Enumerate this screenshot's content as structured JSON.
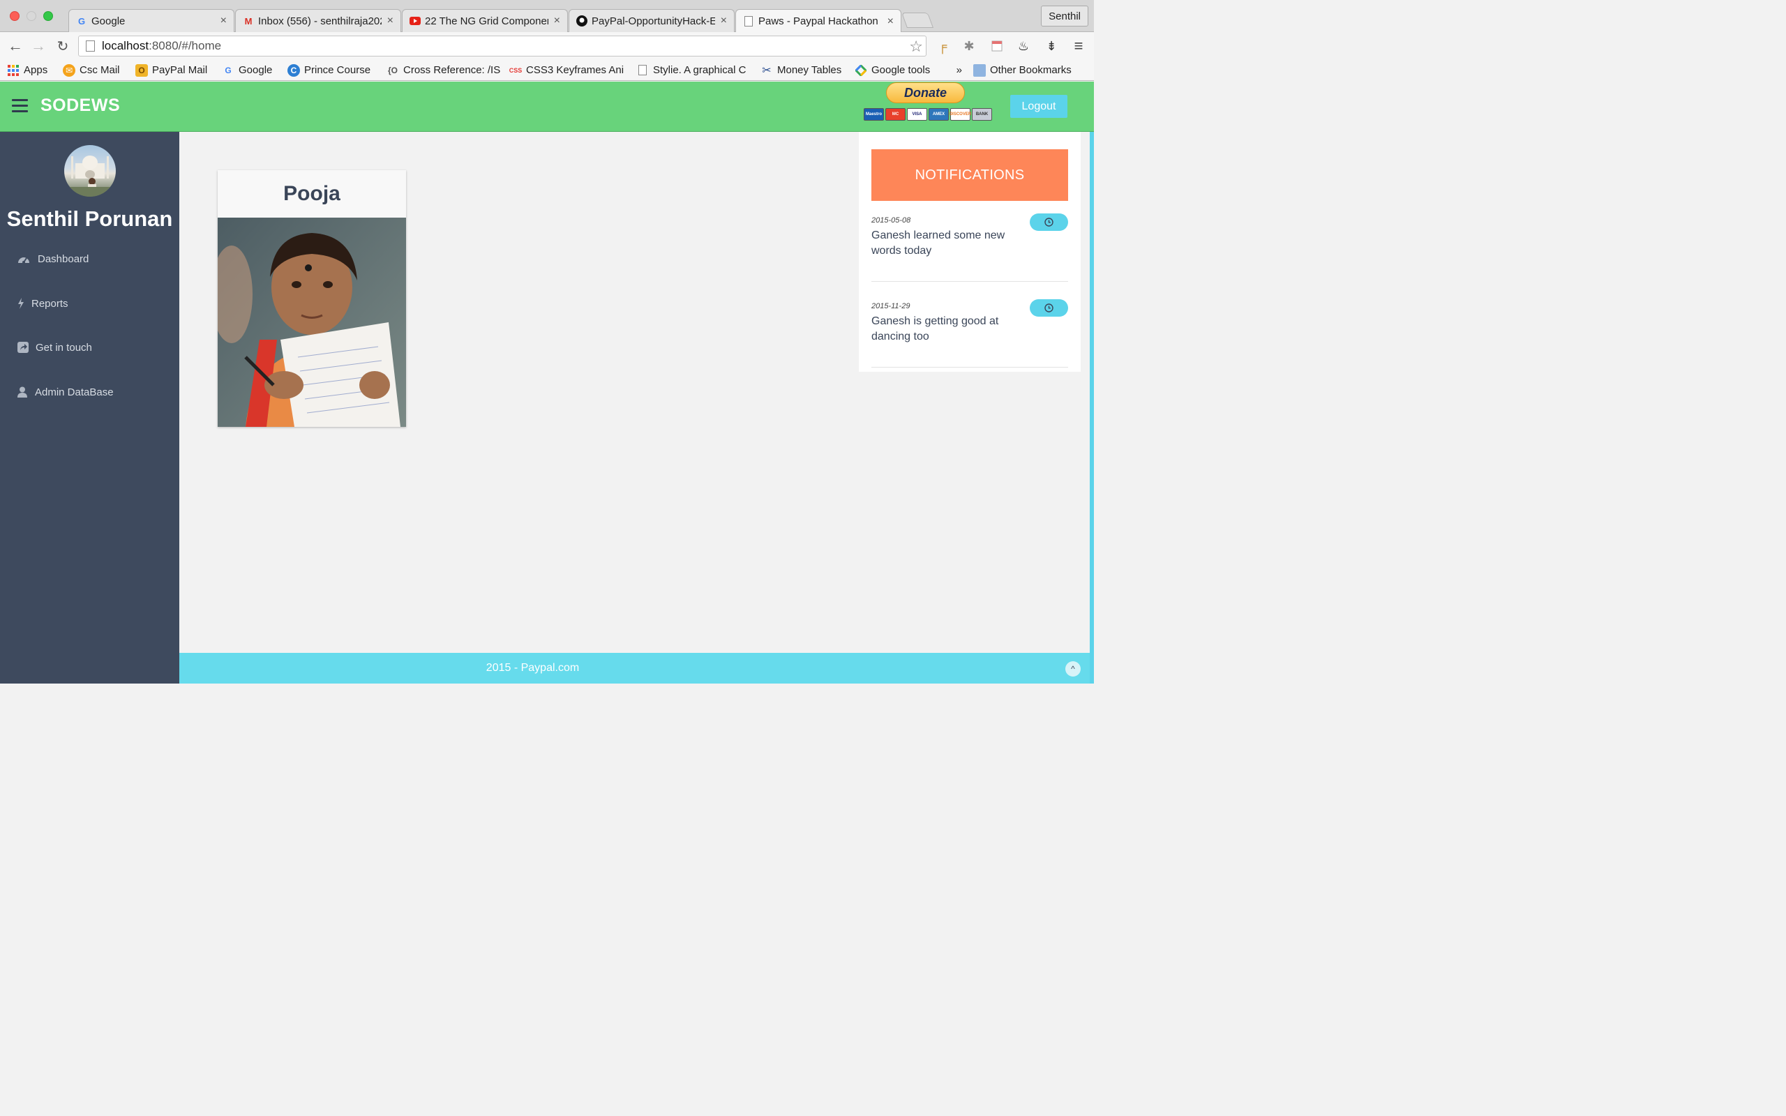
{
  "browser": {
    "tabs": [
      {
        "title": "Google",
        "favicon": "google-icon"
      },
      {
        "title": "Inbox (556) - senthilraja202",
        "favicon": "gmail-icon"
      },
      {
        "title": "22 The NG Grid Componen",
        "favicon": "youtube-icon"
      },
      {
        "title": "PayPal-OpportunityHack-E",
        "favicon": "github-icon"
      },
      {
        "title": "Paws - Paypal Hackathon",
        "favicon": "page-icon"
      }
    ],
    "profile_name": "Senthil",
    "url_host": "localhost",
    "url_path": ":8080/#/home",
    "bookmarks": [
      {
        "label": "Apps"
      },
      {
        "label": "Csc Mail"
      },
      {
        "label": "PayPal Mail"
      },
      {
        "label": "Google"
      },
      {
        "label": "Prince Course"
      },
      {
        "label": "Cross Reference: /IS"
      },
      {
        "label": "CSS3 Keyframes Ani"
      },
      {
        "label": "Stylie. A graphical C"
      },
      {
        "label": "Money Tables"
      },
      {
        "label": "Google tools"
      }
    ],
    "overflow_label": "»",
    "other_bookmarks": "Other Bookmarks"
  },
  "header": {
    "brand": "SODEWS",
    "donate_label": "Donate",
    "logout_label": "Logout",
    "cards": [
      "Maestro",
      "MC",
      "VISA",
      "AMEX",
      "DISCOVER",
      "BANK"
    ]
  },
  "sidebar": {
    "user_name": "Senthil Porunan",
    "items": [
      {
        "label": "Dashboard",
        "icon": "dashboard-icon"
      },
      {
        "label": "Reports",
        "icon": "bolt-icon"
      },
      {
        "label": "Get in touch",
        "icon": "share-icon"
      },
      {
        "label": "Admin DataBase",
        "icon": "user-icon"
      }
    ]
  },
  "main": {
    "child_name": "Pooja"
  },
  "notifications": {
    "title": "NOTIFICATIONS",
    "items": [
      {
        "date": "2015-05-08",
        "text": "Ganesh learned some new words today"
      },
      {
        "date": "2015-11-29",
        "text": "Ganesh is getting good at dancing too"
      }
    ]
  },
  "footer": {
    "text": "2015 - Paypal.com"
  },
  "colors": {
    "header_green": "#68d37b",
    "sidebar_navy": "#3e4a5e",
    "accent_cyan": "#5bd3ea",
    "notification_orange": "#fe8658"
  }
}
